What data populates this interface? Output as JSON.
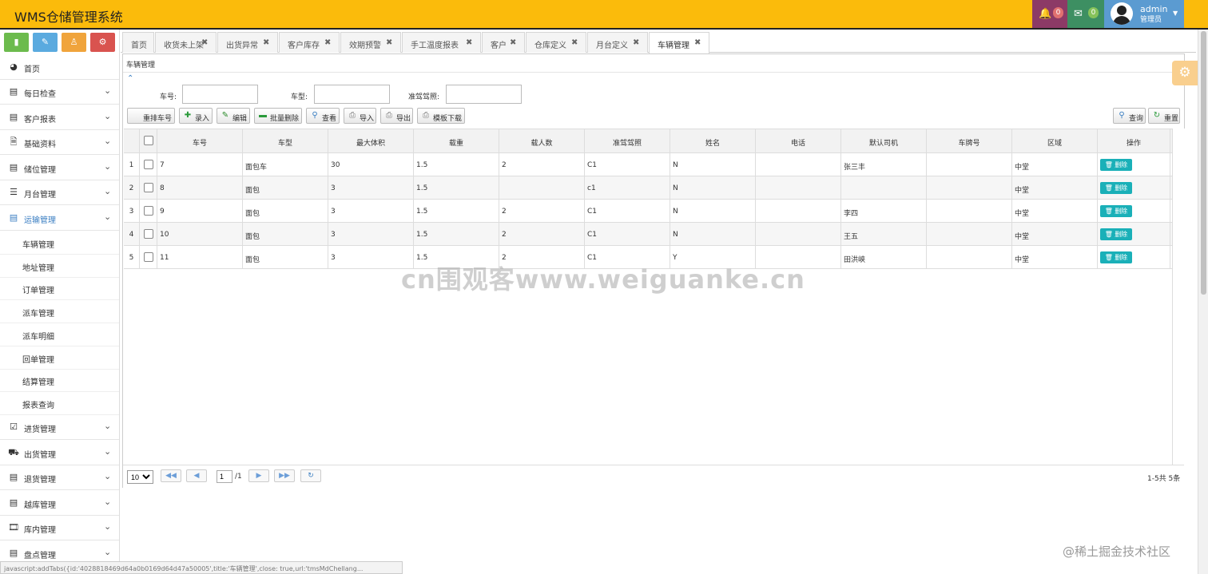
{
  "header": {
    "title": "WMS仓储管理系统",
    "notifications": "0",
    "messages": "0",
    "user_name": "admin",
    "user_role": "管理员",
    "bell_icon": "bell-icon",
    "mail_icon": "envelope-icon"
  },
  "sidebar": {
    "shortcuts": [
      {
        "icon": "signal-icon",
        "color": "#6cbb4d"
      },
      {
        "icon": "pencil-icon",
        "color": "#5aaadf"
      },
      {
        "icon": "users-icon",
        "color": "#f0a43c"
      },
      {
        "icon": "cogs-icon",
        "color": "#d9534f"
      }
    ],
    "home": "首页",
    "groups_top": [
      "每日检查",
      "客户报表",
      "基础资料",
      "储位管理",
      "月台管理",
      "运输管理"
    ],
    "transport_subitems": [
      "车辆管理",
      "地址管理",
      "订单管理",
      "派车管理",
      "派车明细",
      "回单管理",
      "结算管理",
      "报表查询"
    ],
    "groups_bottom": [
      "进货管理",
      "出货管理",
      "退货管理",
      "越库管理",
      "库内管理",
      "盘点管理"
    ]
  },
  "tabs": [
    {
      "label": "首页",
      "closable": false
    },
    {
      "label": "收货未上架",
      "closable": true
    },
    {
      "label": "出货异常",
      "closable": true
    },
    {
      "label": "客户库存",
      "closable": true
    },
    {
      "label": "效期预警",
      "closable": true
    },
    {
      "label": "手工温度报表",
      "closable": true
    },
    {
      "label": "客户",
      "closable": true
    },
    {
      "label": "仓库定义",
      "closable": true
    },
    {
      "label": "月台定义",
      "closable": true
    },
    {
      "label": "车辆管理",
      "closable": true,
      "active": true
    }
  ],
  "panel": {
    "title": "车辆管理",
    "filters": {
      "plate_label": "车号:",
      "type_label": "车型:",
      "license_label": "准驾驾照:"
    },
    "toolbar": {
      "reorder": "重排车号",
      "add": "录入",
      "edit": "编辑",
      "batch_delete": "批量删除",
      "view": "查看",
      "import": "导入",
      "export": "导出",
      "template": "模板下载",
      "query": "查询",
      "reset": "重置"
    }
  },
  "grid": {
    "columns": [
      "车号",
      "车型",
      "最大体积",
      "载重",
      "载人数",
      "准驾驾照",
      "姓名",
      "电话",
      "默认司机",
      "车牌号",
      "区域",
      "操作"
    ],
    "delete_label": "删除",
    "rows": [
      {
        "n": "1",
        "cells": [
          "7",
          "面包车",
          "30",
          "1.5",
          "2",
          "C1",
          "N",
          "",
          "张三丰",
          "",
          "中堂"
        ]
      },
      {
        "n": "2",
        "cells": [
          "8",
          "面包",
          "3",
          "1.5",
          "",
          "c1",
          "N",
          "",
          "",
          "",
          "中堂"
        ]
      },
      {
        "n": "3",
        "cells": [
          "9",
          "面包",
          "3",
          "1.5",
          "2",
          "C1",
          "N",
          "",
          "李四",
          "",
          "中堂"
        ]
      },
      {
        "n": "4",
        "cells": [
          "10",
          "面包",
          "3",
          "1.5",
          "2",
          "C1",
          "N",
          "",
          "王五",
          "",
          "中堂"
        ]
      },
      {
        "n": "5",
        "cells": [
          "11",
          "面包",
          "3",
          "1.5",
          "2",
          "C1",
          "Y",
          "",
          "田洪峡",
          "",
          "中堂"
        ]
      }
    ]
  },
  "pager": {
    "page_size": "10",
    "page": "1",
    "total_pages": "/1",
    "info": "1-5共 5条"
  },
  "watermark": "cn围观客www.weiguanke.cn",
  "watermark2": "@稀土掘金技术社区",
  "status_bar": "javascript:addTabs({id:'4028818469d64a0b0169d64d47a50005',title:'车辆管理',close: true,url:'tmsMdChellang...",
  "colors": {
    "header_bg": "#fbbb0b",
    "accent": "#3a7ec2",
    "delete_btn": "#1ab0b8"
  }
}
